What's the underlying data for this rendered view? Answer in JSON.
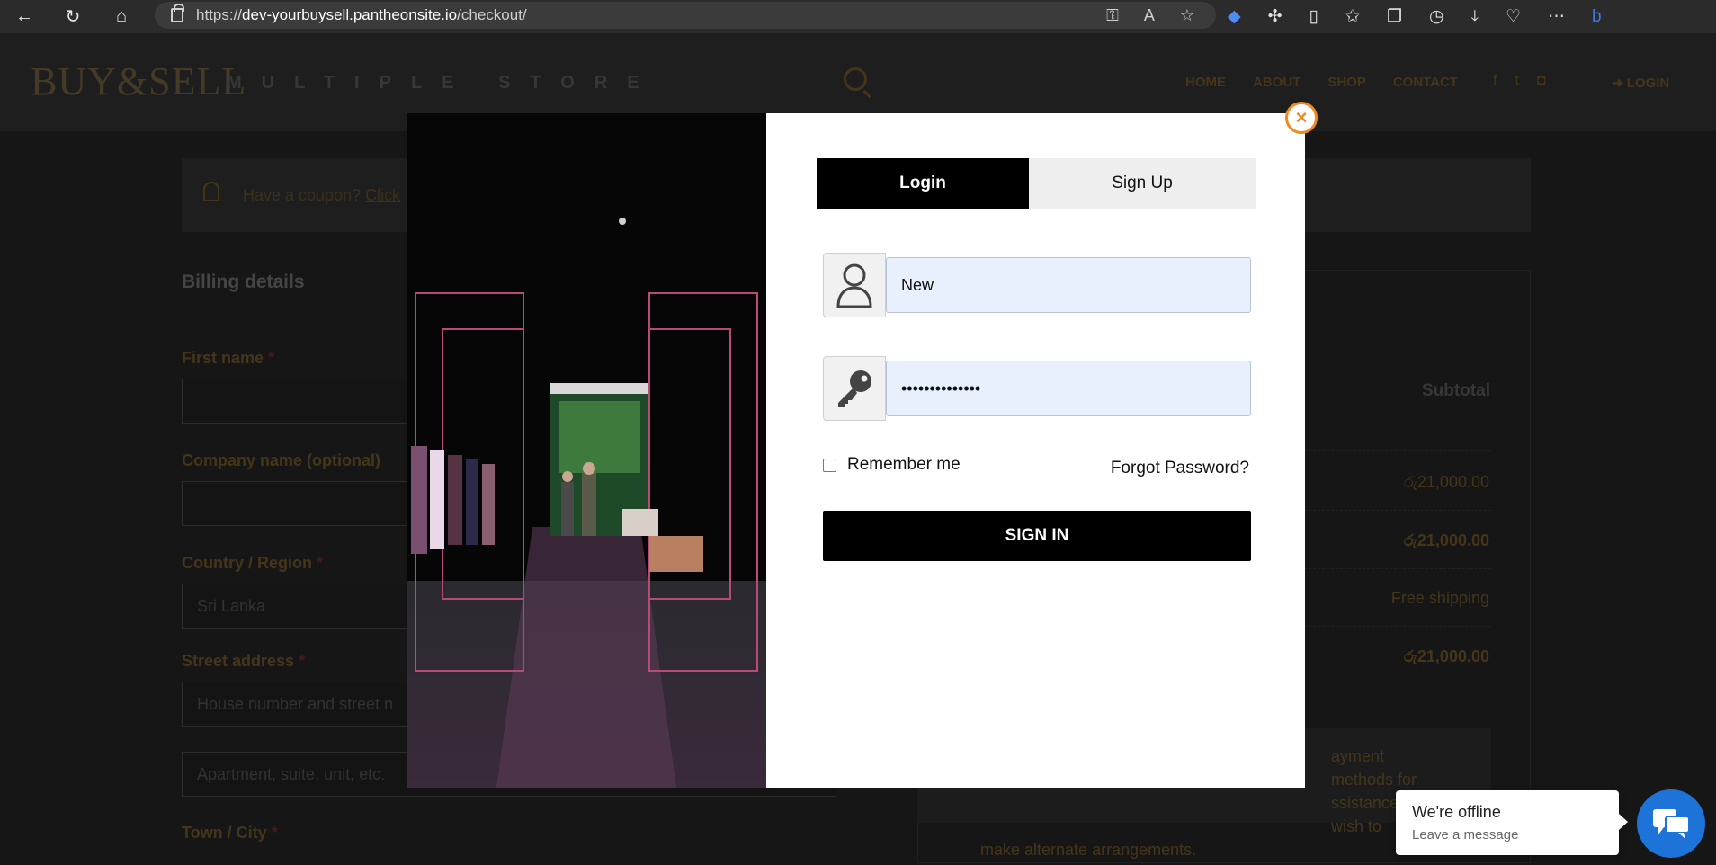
{
  "browser": {
    "url_prefix": "https://",
    "url_host": "dev-yourbuysell.pantheonsite.io",
    "url_path": "/checkout/"
  },
  "site": {
    "logo": "BUY&SELL",
    "tagline": "MULTIPLE STORE",
    "nav": [
      "HOME",
      "ABOUT",
      "SHOP",
      "CONTACT"
    ],
    "login_label": "LOGIN",
    "coupon_text": "Have a coupon?",
    "coupon_link": "Click",
    "billing_title": "Billing details",
    "fields": {
      "first_name": "First name",
      "company": "Company name (optional)",
      "country": "Country / Region",
      "country_value": "Sri Lanka",
      "street": "Street address",
      "street_placeholder": "House number and street n",
      "apartment_placeholder": "Apartment, suite, unit, etc.",
      "town": "Town / City",
      "required_mark": "*"
    },
    "order": {
      "subtotal_label": "Subtotal",
      "line1": "රු21,000.00",
      "line2": "රු21,000.00",
      "shipping": "Free shipping",
      "total": "රු21,000.00",
      "payment_note_1": "ayment methods for",
      "payment_note_2": "ssistance or wish to",
      "payment_note_3": "make alternate arrangements."
    }
  },
  "modal": {
    "tab_login": "Login",
    "tab_signup": "Sign Up",
    "username_value": "New",
    "password_value": "••••••••••••••",
    "remember_label": "Remember me",
    "forgot_label": "Forgot Password?",
    "signin_label": "SIGN IN",
    "close_symbol": "×",
    "accent_color": "#f08a1c"
  },
  "chat": {
    "title": "We're offline",
    "subtitle": "Leave a message"
  }
}
